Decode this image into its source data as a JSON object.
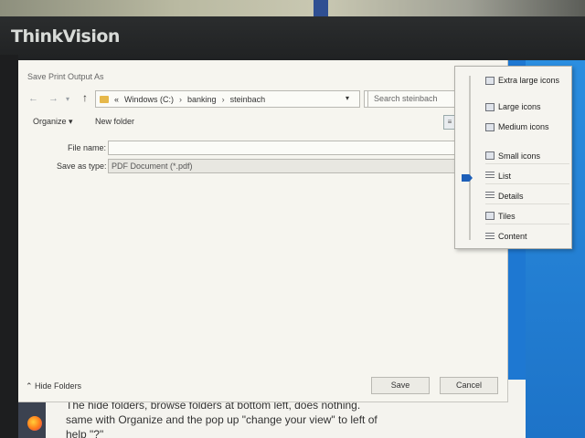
{
  "monitor": {
    "brand": "ThinkVision"
  },
  "dialog": {
    "title": "Save Print Output As",
    "breadcrumb": {
      "prefix": "«",
      "items": [
        "Windows (C:)",
        "banking",
        "steinbach"
      ],
      "separator": "›"
    },
    "search_placeholder": "Search steinbach",
    "toolbar": {
      "organize": "Organize ▾",
      "new_folder": "New folder"
    },
    "fields": {
      "filename_label": "File name:",
      "filename_value": "",
      "type_label": "Save as type:",
      "type_value": "PDF Document (*.pdf)"
    },
    "hide_folders": "⌃ Hide Folders",
    "buttons": {
      "save": "Save",
      "cancel": "Cancel"
    }
  },
  "view_menu": {
    "selected": "List",
    "items": [
      {
        "label": "Extra large icons",
        "icon": "extra-large-icons-icon"
      },
      {
        "label": "Large icons",
        "icon": "large-icons-icon"
      },
      {
        "label": "Medium icons",
        "icon": "medium-icons-icon"
      },
      {
        "label": "Small icons",
        "icon": "small-icons-icon"
      },
      {
        "label": "List",
        "icon": "list-view-icon"
      },
      {
        "label": "Details",
        "icon": "details-view-icon"
      },
      {
        "label": "Tiles",
        "icon": "tiles-view-icon"
      },
      {
        "label": "Content",
        "icon": "content-view-icon"
      }
    ]
  },
  "note": {
    "line1": "The hide folders, browse folders at bottom left, does nothing.",
    "line2": "same with Organize and the pop up \"change your view\" to left of",
    "line3": "help \"?\""
  },
  "colors": {
    "accent": "#1d5fb8",
    "dialog_bg": "#f6f5ef",
    "desktop": "#1e78d2"
  }
}
